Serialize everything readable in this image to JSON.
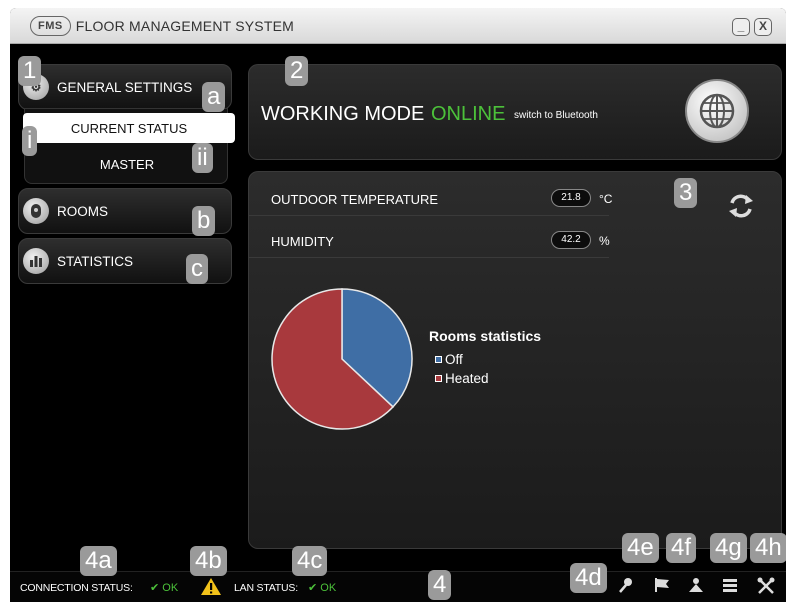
{
  "window": {
    "logo": "FMS",
    "title": "FLOOR MANAGEMENT SYSTEM",
    "minimize_label": "_",
    "close_label": "X"
  },
  "nav": {
    "general_settings": "GENERAL SETTINGS",
    "current_status": "CURRENT STATUS",
    "master": "MASTER",
    "rooms": "ROOMS",
    "statistics": "STATISTICS"
  },
  "mode": {
    "label": "WORKING MODE",
    "value": "ONLINE",
    "link": "switch to Bluetooth",
    "value_color": "#4cc13a"
  },
  "readings": [
    {
      "label": "OUTDOOR TEMPERATURE",
      "value": "21.8",
      "unit": "°C"
    },
    {
      "label": "HUMIDITY",
      "value": "42.2",
      "unit": "%"
    }
  ],
  "chart_data": {
    "type": "pie",
    "title": "Rooms statistics",
    "categories": [
      "Off",
      "Heated"
    ],
    "values": [
      37,
      63
    ],
    "colors": [
      "#3f6ea5",
      "#a8393d"
    ],
    "legend": "right"
  },
  "callouts": {
    "c1": "1",
    "c2": "2",
    "c3": "3",
    "c4": "4",
    "ca": "a",
    "cb": "b",
    "cc": "c",
    "ci": "i",
    "cii": "ii",
    "c4a": "4a",
    "c4b": "4b",
    "c4c": "4c",
    "c4d": "4d",
    "c4e": "4e",
    "c4f": "4f",
    "c4g": "4g",
    "c4h": "4h"
  },
  "status": {
    "connection_label": "CONNECTION STATUS:",
    "connection_value": "✔ OK",
    "lan_label": "LAN STATUS:",
    "lan_value": "✔ OK",
    "ok_color": "#4cc13a",
    "icons": [
      "key-icon",
      "flag-icon",
      "user-icon",
      "layers-icon",
      "tools-icon"
    ]
  }
}
